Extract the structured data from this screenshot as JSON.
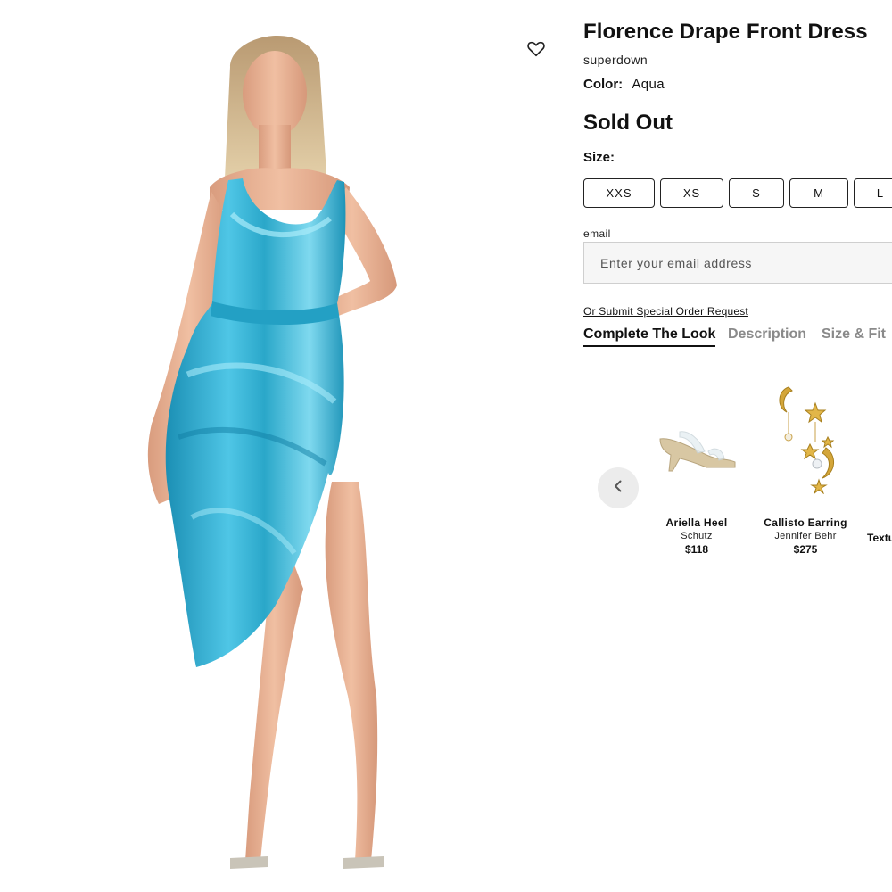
{
  "product": {
    "title": "Florence Drape Front Dress",
    "brand": "superdown",
    "color_label": "Color:",
    "color_value": "Aqua",
    "status": "Sold Out",
    "size_label": "Size:",
    "sizes": [
      "XXS",
      "XS",
      "S",
      "M",
      "L"
    ],
    "dress_color": "#2aa7c9"
  },
  "email": {
    "label": "email",
    "placeholder": "Enter your email address"
  },
  "special_order_link": "Or Submit Special Order Request",
  "tabs": [
    {
      "label": "Complete The Look",
      "active": true
    },
    {
      "label": "Description",
      "active": false
    },
    {
      "label": "Size & Fit",
      "active": false
    }
  ],
  "complete_the_look": {
    "items": [
      {
        "name": "Ariella Heel",
        "brand": "Schutz",
        "price": "$118",
        "icon": "heel-image"
      },
      {
        "name": "Callisto Earring",
        "brand": "Jennifer Behr",
        "price": "$275",
        "icon": "earring-image"
      }
    ],
    "partial_item_name": "Textu"
  },
  "icons": {
    "wishlist": "heart-icon",
    "carousel_prev": "chevron-left-icon"
  }
}
